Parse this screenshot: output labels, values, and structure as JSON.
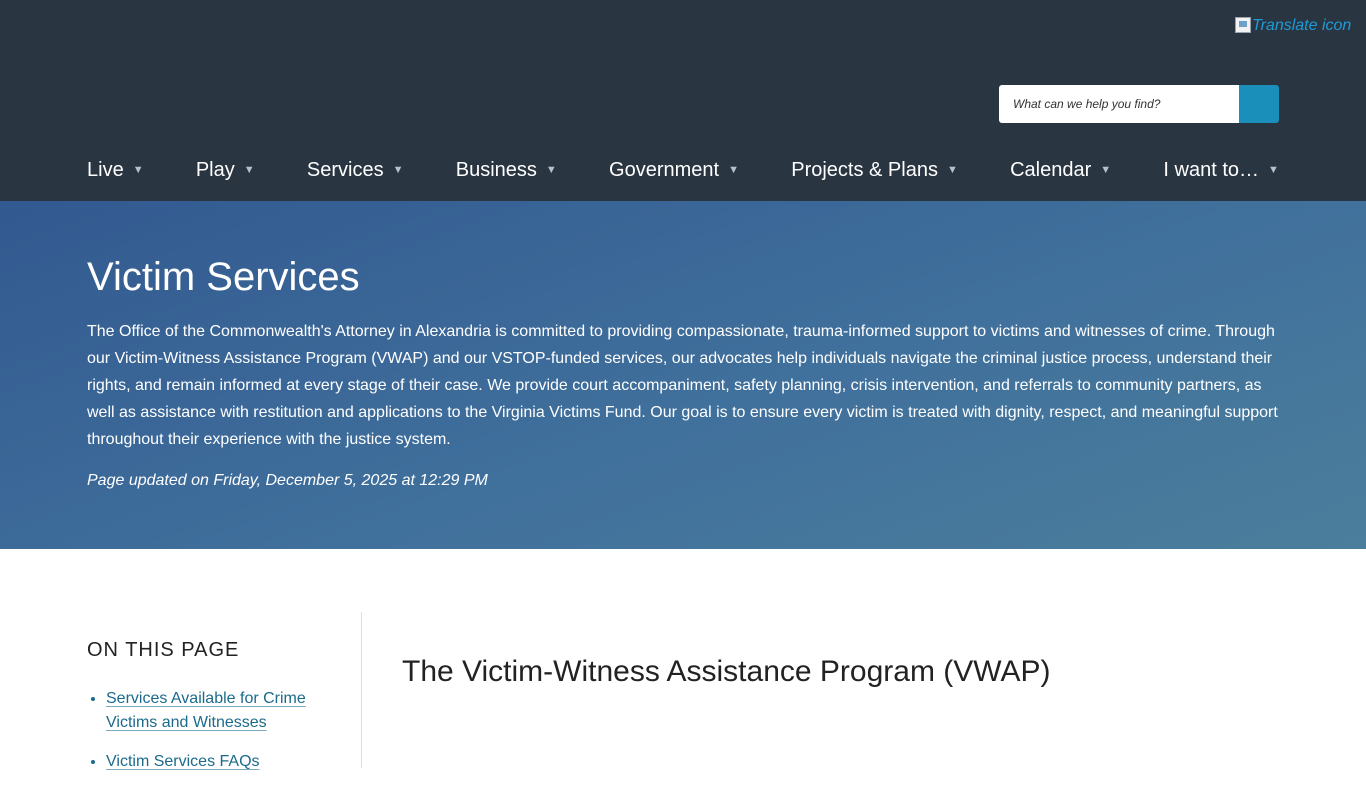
{
  "header": {
    "translate_label": "Translate icon",
    "search": {
      "placeholder": "What can we help you find?"
    },
    "nav": [
      "Live",
      "Play",
      "Services",
      "Business",
      "Government",
      "Projects & Plans",
      "Calendar",
      "I want to…"
    ],
    "caret": "▼"
  },
  "hero": {
    "title": "Victim Services",
    "description": "The Office of the Commonwealth's Attorney in Alexandria is committed to providing compassionate, trauma-informed support to victims and witnesses of crime. Through our Victim-Witness Assistance Program (VWAP) and our VSTOP-funded services, our advocates help individuals navigate the criminal justice process, understand their rights, and remain informed at every stage of their case. We provide court accompaniment, safety planning, crisis intervention, and referrals to community partners, as well as assistance with restitution and applications to the Virginia Victims Fund. Our goal is to ensure every victim is treated with dignity, respect, and meaningful support throughout their experience with the justice system.",
    "updated": "Page updated on Friday, December 5, 2025 at 12:29 PM"
  },
  "sidebar": {
    "heading": "ON THIS PAGE",
    "links": [
      "Services Available for Crime Victims and Witnesses",
      "Victim Services FAQs"
    ]
  },
  "main": {
    "heading": "The Victim-Witness Assistance Program (VWAP)"
  },
  "colors": {
    "header_bg": "#2a3542",
    "search_button": "#1a8fba",
    "link": "#1b6a8c",
    "hero_gradient_start": "#325990",
    "hero_gradient_end": "#4b7e9c"
  }
}
